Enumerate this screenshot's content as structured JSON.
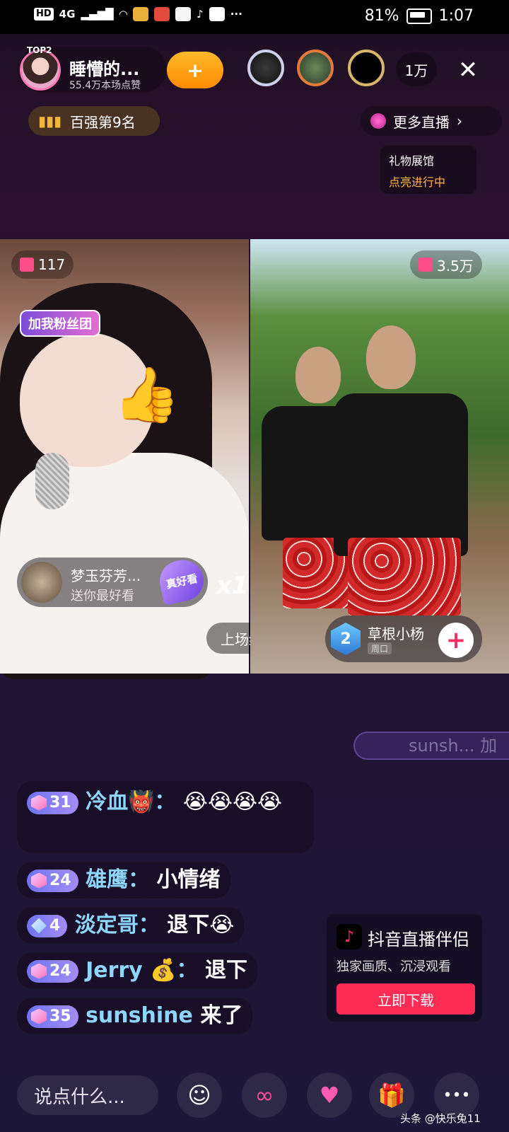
{
  "status_bar": {
    "network": "HD",
    "signal": "4G",
    "battery": "81%",
    "time": "1:07",
    "more": "···"
  },
  "header": {
    "rank_badge": "TOP2",
    "host_name": "睡懵的...",
    "host_likes": "55.4万本场点赞",
    "follow_symbol": "+",
    "viewer_count": "1万",
    "close_symbol": "✕"
  },
  "subheader": {
    "rank_label": "百强第9名",
    "more_live_label": "更多直播",
    "more_live_chevron": "›",
    "gift_hall_title": "礼物展馆",
    "gift_hall_status": "点亮进行中"
  },
  "battle": {
    "left": {
      "gift_count": "117",
      "fan_tag": "加我粉丝团",
      "gift_sender": "梦玉芬芳...",
      "gift_message": "送你最好看",
      "gift_name": "真好看",
      "gift_multiplier": "x1",
      "last_result_label": "上场结果"
    },
    "right": {
      "gift_count": "3.5万",
      "partner_level": "2",
      "partner_name": "草根小杨",
      "partner_period": "周口",
      "follow_symbol": "+"
    }
  },
  "entry_notice": "sunsh... 加",
  "chat": [
    {
      "level": "31",
      "name": "冷血👹：",
      "message": "😭😭😭😭",
      "icon": "hexagon-badge"
    },
    {
      "level": "24",
      "name": "雄鹰：",
      "message": "小情绪",
      "icon": "hexagon-badge"
    },
    {
      "level": "4",
      "name": "淡定哥：",
      "message": "退下😭",
      "icon": "diamond-badge"
    },
    {
      "level": "24",
      "name": "Jerry 💰：",
      "message": "退下",
      "icon": "hexagon-badge"
    },
    {
      "level": "35",
      "name": "sunshine",
      "message": "来了",
      "icon": "hexagon-badge"
    }
  ],
  "ad": {
    "title": "抖音直播伴侣",
    "subtitle": "独家画质、沉浸观看",
    "button": "立即下载"
  },
  "bottom_bar": {
    "input_placeholder": "说点什么...",
    "emoji_icon": "☺",
    "link_icon": "∞",
    "heart_icon": "♥",
    "gift_icon": "🎁",
    "more_icon": "•••"
  },
  "watermark": "头条 @快乐兔11",
  "colors": {
    "accent_pink": "#fe2c55",
    "chat_name": "#8fd6ff",
    "follow_orange": "#ff9e10"
  }
}
